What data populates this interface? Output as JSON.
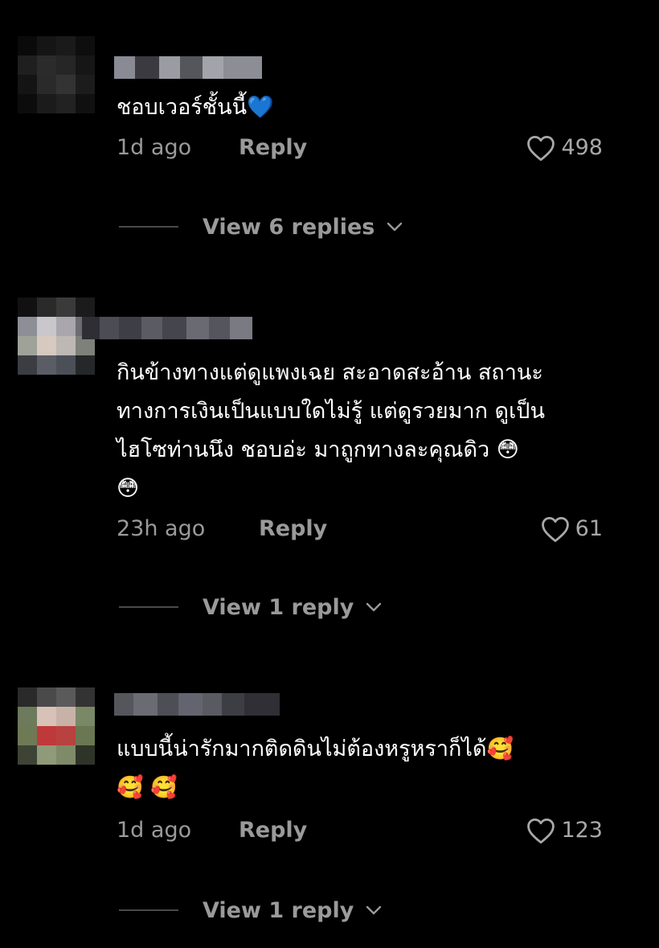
{
  "colors": {
    "background": "#000000",
    "text_primary": "#ffffff",
    "text_secondary": "#9a9a9a",
    "heart_blue": "#5aa9e6"
  },
  "comments": [
    {
      "text": "ชอบเวอร์ชั้นนี้💙",
      "time": "1d ago",
      "reply_label": "Reply",
      "likes": "498",
      "view_replies": "View 6 replies"
    },
    {
      "text": "กินข้างทางแต่ดูแพงเฉย สะอาดสะอ้าน สถานะ\nทางการเงินเป็นแบบใดไม่รู้ แต่ดูรวยมาก ดูเป็น\nไฮโซท่านนึง ชอบอ่ะ มาถูกทางละคุณดิว 😳\n😳",
      "time": "23h ago",
      "reply_label": "Reply",
      "likes": "61",
      "view_replies": "View 1 reply"
    },
    {
      "text": "แบบนี้น่ารักมากติดดินไม่ต้องหรูหราก็ได้🥰\n🥰 🥰",
      "time": "1d ago",
      "reply_label": "Reply",
      "likes": "123",
      "view_replies": "View 1 reply"
    }
  ],
  "icons": {
    "like": "heart-outline-icon",
    "expand": "chevron-down-icon",
    "avatar": "pixelated-avatar"
  }
}
